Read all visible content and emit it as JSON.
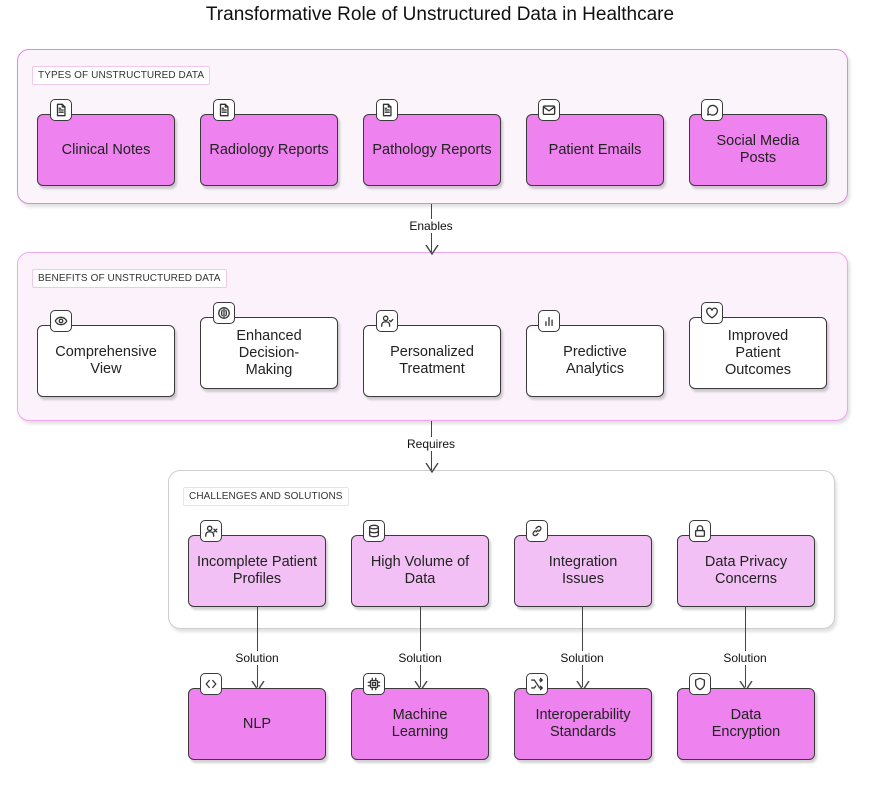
{
  "title": "Transformative Role of Unstructured Data in Healthcare",
  "colors": {
    "primary_node": "#ee82ee",
    "challenge_node": "#f2c0f4",
    "benefit_node": "#ffffff",
    "group_border": "#d98be0"
  },
  "groups": {
    "types": {
      "label": "TYPES OF UNSTRUCTURED DATA",
      "nodes": [
        {
          "label": "Clinical Notes",
          "icon": "document-icon"
        },
        {
          "label": "Radiology Reports",
          "icon": "document-icon"
        },
        {
          "label": "Pathology Reports",
          "icon": "document-icon"
        },
        {
          "label": "Patient Emails",
          "icon": "mail-icon"
        },
        {
          "label": "Social Media Posts",
          "icon": "message-circle-icon"
        }
      ]
    },
    "benefits": {
      "label": "BENEFITS OF UNSTRUCTURED DATA",
      "nodes": [
        {
          "label": "Comprehensive View",
          "icon": "eye-icon"
        },
        {
          "label": "Enhanced Decision-Making",
          "icon": "brain-icon"
        },
        {
          "label": "Personalized Treatment",
          "icon": "user-check-icon"
        },
        {
          "label": "Predictive Analytics",
          "icon": "bar-chart-icon"
        },
        {
          "label": "Improved Patient Outcomes",
          "icon": "heart-icon"
        }
      ]
    },
    "challenges": {
      "label": "CHALLENGES AND SOLUTIONS",
      "nodes": [
        {
          "label": "Incomplete Patient Profiles",
          "icon": "user-x-icon"
        },
        {
          "label": "High Volume of Data",
          "icon": "database-icon"
        },
        {
          "label": "Integration Issues",
          "icon": "link-icon"
        },
        {
          "label": "Data Privacy Concerns",
          "icon": "lock-icon"
        }
      ]
    }
  },
  "solutions": [
    {
      "label": "NLP",
      "icon": "code-icon"
    },
    {
      "label": "Machine Learning",
      "icon": "cpu-icon"
    },
    {
      "label": "Interoperability Standards",
      "icon": "shuffle-icon"
    },
    {
      "label": "Data Encryption",
      "icon": "shield-icon"
    }
  ],
  "edges": {
    "types_to_benefits": "Enables",
    "benefits_to_challenges": "Requires",
    "challenge_to_solution": [
      "Solution",
      "Solution",
      "Solution",
      "Solution"
    ]
  }
}
